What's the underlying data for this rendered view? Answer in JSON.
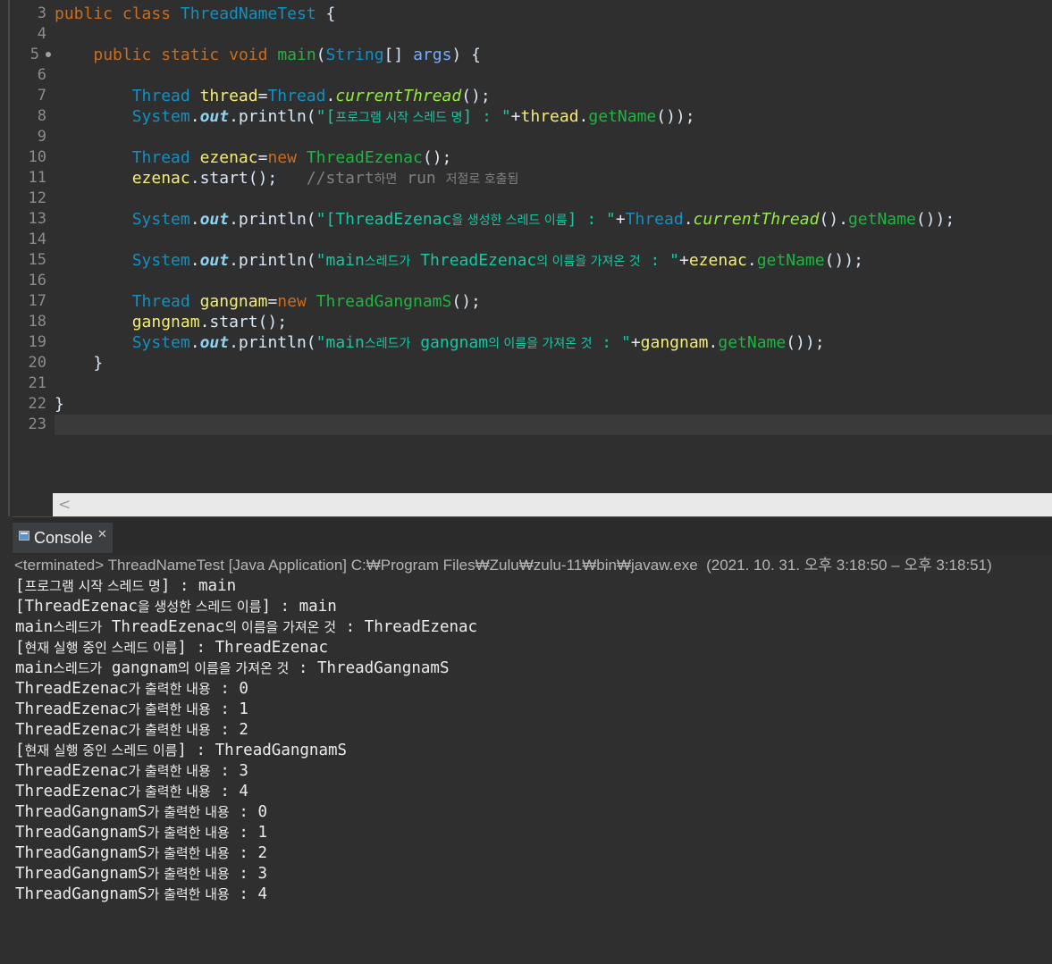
{
  "editor": {
    "line_numbers": [
      "3",
      "4",
      "5",
      "6",
      "7",
      "8",
      "9",
      "10",
      "11",
      "12",
      "13",
      "14",
      "15",
      "16",
      "17",
      "18",
      "19",
      "20",
      "21",
      "22",
      "23"
    ],
    "code": {
      "l3": {
        "kw1": "public",
        "kw2": "class",
        "cls": "ThreadNameTest",
        "brace": " {"
      },
      "l5": {
        "kw1": "public",
        "kw2": "static",
        "kw3": "void",
        "method": "main",
        "p1": "(",
        "type": "String",
        "p2": "[] ",
        "param": "args",
        "p3": ") {"
      },
      "l7": {
        "type": "Thread",
        "var": "thread",
        "eq": "=",
        "cls": "Thread",
        "dot": ".",
        "call": "currentThread",
        "end": "();"
      },
      "l8": {
        "cls": "System",
        "dot": ".",
        "field": "out",
        "call": ".println(",
        "str_a": "\"[",
        "str_k": "프로그램 시작 스레드 명",
        "str_b": "] : \"",
        "plus": "+",
        "var": "thread",
        "dot2": ".",
        "m": "getName",
        "end": "());"
      },
      "l10": {
        "type": "Thread",
        "var": "ezenac",
        "eq": "=",
        "kw": "new",
        "cls": "ThreadEzenac",
        "end": "();"
      },
      "l11": {
        "var": "ezenac",
        "call": ".start();",
        "cm_a": "   //start",
        "cm_k1": "하면",
        "cm_b": " run ",
        "cm_k2": "저절로 호출됨"
      },
      "l13": {
        "cls": "System",
        "dot": ".",
        "field": "out",
        "call": ".println(",
        "str_a": "\"[ThreadEzenac",
        "str_k": "을 생성한 스레드 이름",
        "str_b": "] : \"",
        "plus": "+",
        "cls2": "Thread",
        "dot2": ".",
        "call2": "currentThread",
        "mid": "().",
        "m": "getName",
        "end": "());"
      },
      "l15": {
        "cls": "System",
        "dot": ".",
        "field": "out",
        "call": ".println(",
        "str_a": "\"main",
        "str_k1": "스레드가",
        "str_b": " ThreadEzenac",
        "str_k2": "의 이름을 가져온 것",
        "str_c": " : \"",
        "plus": "+",
        "var": "ezenac",
        "dot2": ".",
        "m": "getName",
        "end": "());"
      },
      "l17": {
        "type": "Thread",
        "var": "gangnam",
        "eq": "=",
        "kw": "new",
        "cls": "ThreadGangnamS",
        "end": "();"
      },
      "l18": {
        "var": "gangnam",
        "call": ".start();"
      },
      "l19": {
        "cls": "System",
        "dot": ".",
        "field": "out",
        "call": ".println(",
        "str_a": "\"main",
        "str_k1": "스레드가",
        "str_b": " gangnam",
        "str_k2": "의 이름을 가져온 것",
        "str_c": " : \"",
        "plus": "+",
        "var": "gangnam",
        "dot2": ".",
        "m": "getName",
        "end": "());"
      },
      "l20": {
        "brace": "}"
      },
      "l22": {
        "brace": "}"
      }
    }
  },
  "console": {
    "tab_label": "Console",
    "close_glyph": "✕",
    "terminated_text": "<terminated> ThreadNameTest [Java Application] C:₩Program Files₩Zulu₩zulu-11₩bin₩javaw.exe  (2021. 10. 31. 오후 3:18:50 – 오후 3:18:51)",
    "output": [
      {
        "a": "[",
        "k": "프로그램 시작 스레드 명",
        "b": "] : main"
      },
      {
        "a": "[ThreadEzenac",
        "k": "을 생성한 스레드 이름",
        "b": "] : main"
      },
      {
        "a": "main",
        "k": "스레드가",
        "b": " ThreadEzenac",
        "k2": "의 이름을 가져온 것",
        "c": " : ThreadEzenac"
      },
      {
        "a": "[",
        "k": "현재 실행 중인 스레드 이름",
        "b": "] : ThreadEzenac"
      },
      {
        "a": "main",
        "k": "스레드가",
        "b": " gangnam",
        "k2": "의 이름을 가져온 것",
        "c": " : ThreadGangnamS"
      },
      {
        "a": "ThreadEzenac",
        "k": "가 출력한 내용",
        "b": " : 0"
      },
      {
        "a": "ThreadEzenac",
        "k": "가 출력한 내용",
        "b": " : 1"
      },
      {
        "a": "ThreadEzenac",
        "k": "가 출력한 내용",
        "b": " : 2"
      },
      {
        "a": "[",
        "k": "현재 실행 중인 스레드 이름",
        "b": "] : ThreadGangnamS"
      },
      {
        "a": "ThreadEzenac",
        "k": "가 출력한 내용",
        "b": " : 3"
      },
      {
        "a": "ThreadEzenac",
        "k": "가 출력한 내용",
        "b": " : 4"
      },
      {
        "a": "ThreadGangnamS",
        "k": "가 출력한 내용",
        "b": " : 0"
      },
      {
        "a": "ThreadGangnamS",
        "k": "가 출력한 내용",
        "b": " : 1"
      },
      {
        "a": "ThreadGangnamS",
        "k": "가 출력한 내용",
        "b": " : 2"
      },
      {
        "a": "ThreadGangnamS",
        "k": "가 출력한 내용",
        "b": " : 3"
      },
      {
        "a": "ThreadGangnamS",
        "k": "가 출력한 내용",
        "b": " : 4"
      }
    ]
  },
  "hscroll": {
    "arrow_glyph": "<"
  }
}
